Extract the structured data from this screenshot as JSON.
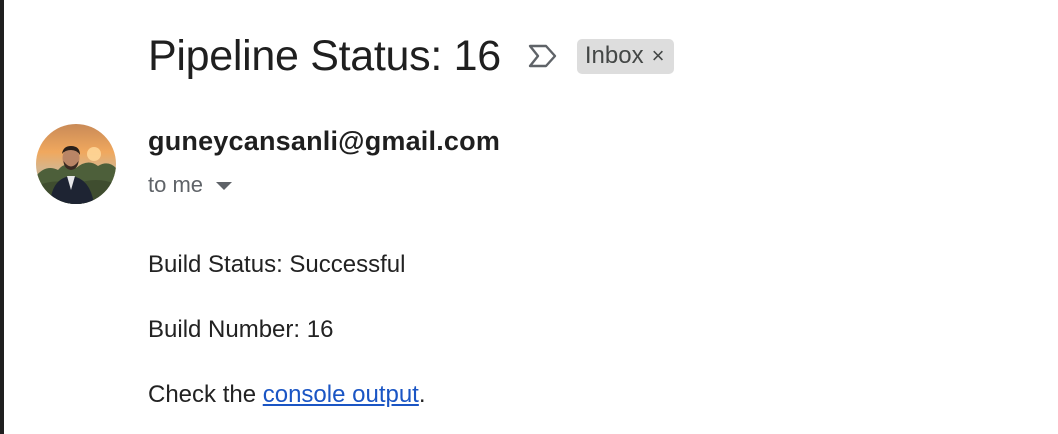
{
  "email": {
    "subject": "Pipeline Status: 16",
    "label": "Inbox",
    "label_close": "×",
    "sender": "guneycansanli@gmail.com",
    "recipient": "to me",
    "body": {
      "status_line": "Build Status: Successful",
      "number_line": "Build Number: 16",
      "check_prefix": "Check the ",
      "link_text": "console output",
      "check_suffix": "."
    }
  },
  "icons": {
    "importance": "importance-marker-icon",
    "recipient_dropdown": "caret-down-icon",
    "avatar": "sender-avatar-photo"
  },
  "colors": {
    "chip_bg": "#dddddd",
    "link": "#1a55c4",
    "secondary_text": "#5f6368"
  }
}
